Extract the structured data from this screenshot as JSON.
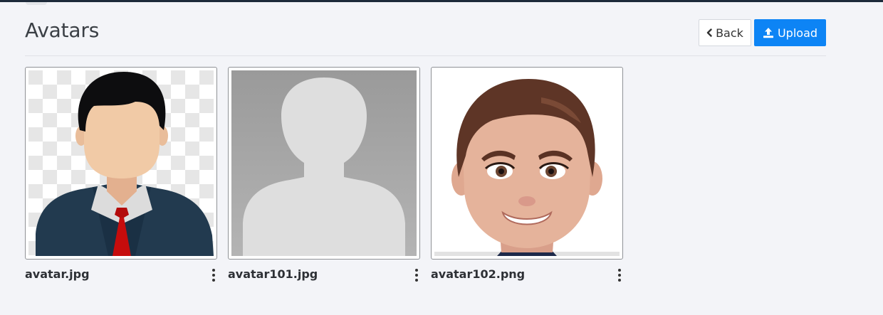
{
  "page": {
    "title": "Avatars"
  },
  "toolbar": {
    "back_label": "Back",
    "upload_label": "Upload",
    "back_icon": "chevron-left-icon",
    "upload_icon": "upload-icon"
  },
  "avatars": [
    {
      "filename": "avatar.jpg",
      "image": "businessman-avatar"
    },
    {
      "filename": "avatar101.jpg",
      "image": "default-silhouette-avatar"
    },
    {
      "filename": "avatar102.png",
      "image": "cartoon-man-avatar"
    }
  ],
  "colors": {
    "accent": "#0d84f5",
    "background": "#f3f4f8",
    "topbar": "#1d2a3a"
  }
}
